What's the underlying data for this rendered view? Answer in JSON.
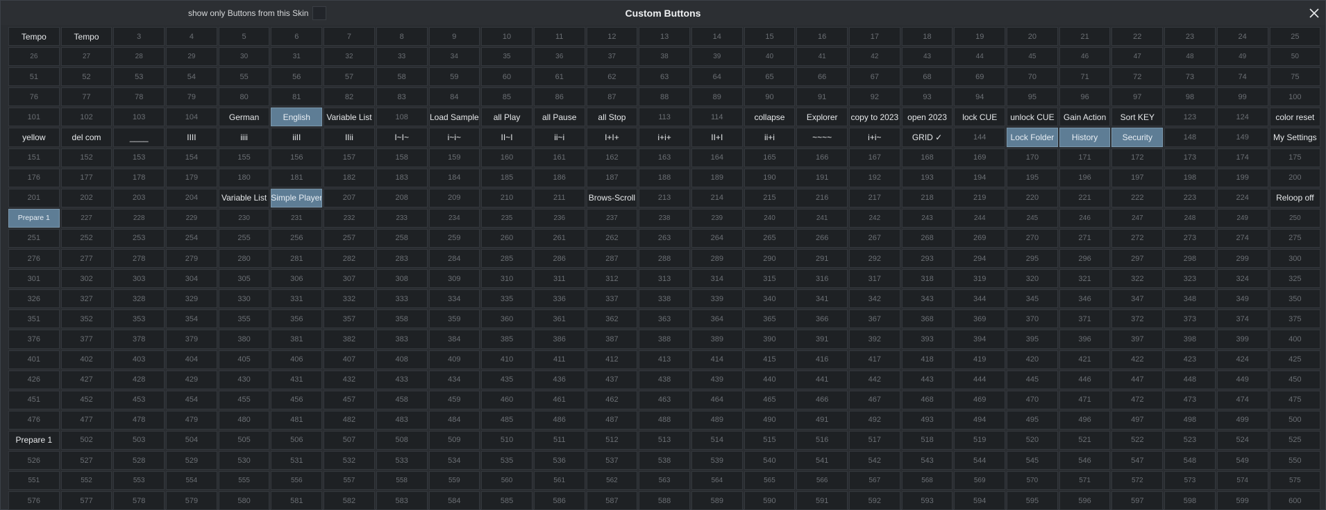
{
  "window": {
    "title": "Custom Buttons",
    "filter_label": "show only Buttons from this Skin"
  },
  "colors": {
    "background": "#2a2d31",
    "cell": "#1e2124",
    "active_cell": "#5e7d95",
    "label_text": "#e6e8ea",
    "number_text": "#6b6f74"
  },
  "grid": {
    "columns": 25,
    "total": 600,
    "small_rows": [
      1,
      9,
      22,
      24
    ],
    "labels": {
      "1": "Tempo",
      "2": "Tempo",
      "105": "German",
      "106": "English",
      "107": "Variable List",
      "109": "Load Sample",
      "110": "all Play",
      "111": "all Pause",
      "112": "all Stop",
      "115": "collapse",
      "116": "Explorer",
      "117": "copy to 2023",
      "118": "open 2023",
      "119": "lock CUE",
      "120": "unlock CUE",
      "121": "Gain Action",
      "122": "Sort KEY",
      "125": "color reset",
      "126": "yellow",
      "127": "del com",
      "128": "____",
      "129": "IIII",
      "130": "iiii",
      "131": "iiII",
      "132": "IIii",
      "133": "I~I~",
      "134": "i~i~",
      "135": "II~I",
      "136": "ii~i",
      "137": "I+I+",
      "138": "i+i+",
      "139": "II+I",
      "140": "ii+i",
      "141": "~~~~",
      "142": "i+i~",
      "143": "GRID ✓",
      "145": "Lock Folder",
      "146": "History",
      "147": "Security",
      "150": "My Settings",
      "205": "Variable List",
      "206": "Simple Player",
      "212": "Brows-Scroll",
      "225": "Reloop off",
      "226": "Prepare 1",
      "501": "Prepare 1"
    },
    "active": [
      106,
      145,
      146,
      147,
      206,
      226
    ]
  }
}
